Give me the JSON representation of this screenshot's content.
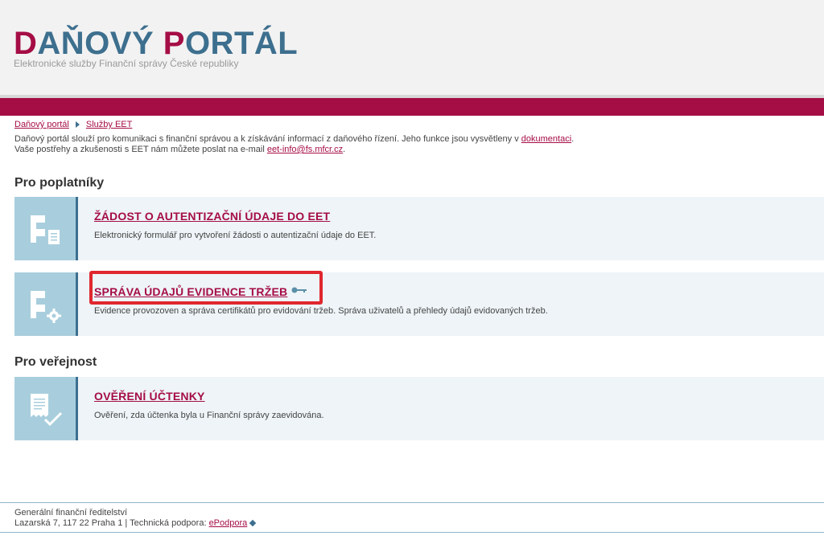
{
  "header": {
    "logo": {
      "part1_cap": "D",
      "part1_rest": "AŇOVÝ ",
      "part2_cap": "P",
      "part2_rest": "ORTÁL"
    },
    "tagline": "Elektronické služby Finanční správy České republiky"
  },
  "breadcrumb": {
    "home": "Daňový portál",
    "current": "Služby EET"
  },
  "intro": {
    "line1_prefix": "Daňový portál slouží pro komunikaci s finanční správou a k získávání informací z daňového řízení. Jeho funkce jsou vysvětleny v ",
    "line1_link": "dokumentaci",
    "line1_suffix": ".",
    "line2_prefix": "Vaše postřehy a zkušenosti s EET nám můžete poslat na e-mail ",
    "line2_link": "eet-info@fs.mfcr.cz",
    "line2_suffix": "."
  },
  "sections": {
    "taxpayers": "Pro poplatníky",
    "public": "Pro veřejnost"
  },
  "cards": {
    "auth": {
      "title": "ŽÁDOST O AUTENTIZAČNÍ ÚDAJE DO EET",
      "desc": "Elektronický formulář pro vytvoření žádosti o autentizační údaje do EET."
    },
    "records": {
      "title": "SPRÁVA ÚDAJŮ EVIDENCE TRŽEB",
      "desc": "Evidence provozoven a správa certifikátů pro evidování tržeb. Správa uživatelů a přehledy údajů evidovaných tržeb."
    },
    "receipt": {
      "title": "OVĚŘENÍ ÚČTENKY",
      "desc": "Ověření, zda účtenka byla u Finanční správy zaevidována."
    }
  },
  "footer": {
    "line1": "Generální finanční ředitelství",
    "line2_prefix": "Lazarská 7, 117 22 Praha 1 | Technická podpora: ",
    "line2_link": "ePodpora"
  },
  "colors": {
    "brand_red": "#a50d45",
    "brand_blue": "#3d6f8e",
    "icon_bg": "#a8cedd",
    "highlight": "#e0262e"
  }
}
